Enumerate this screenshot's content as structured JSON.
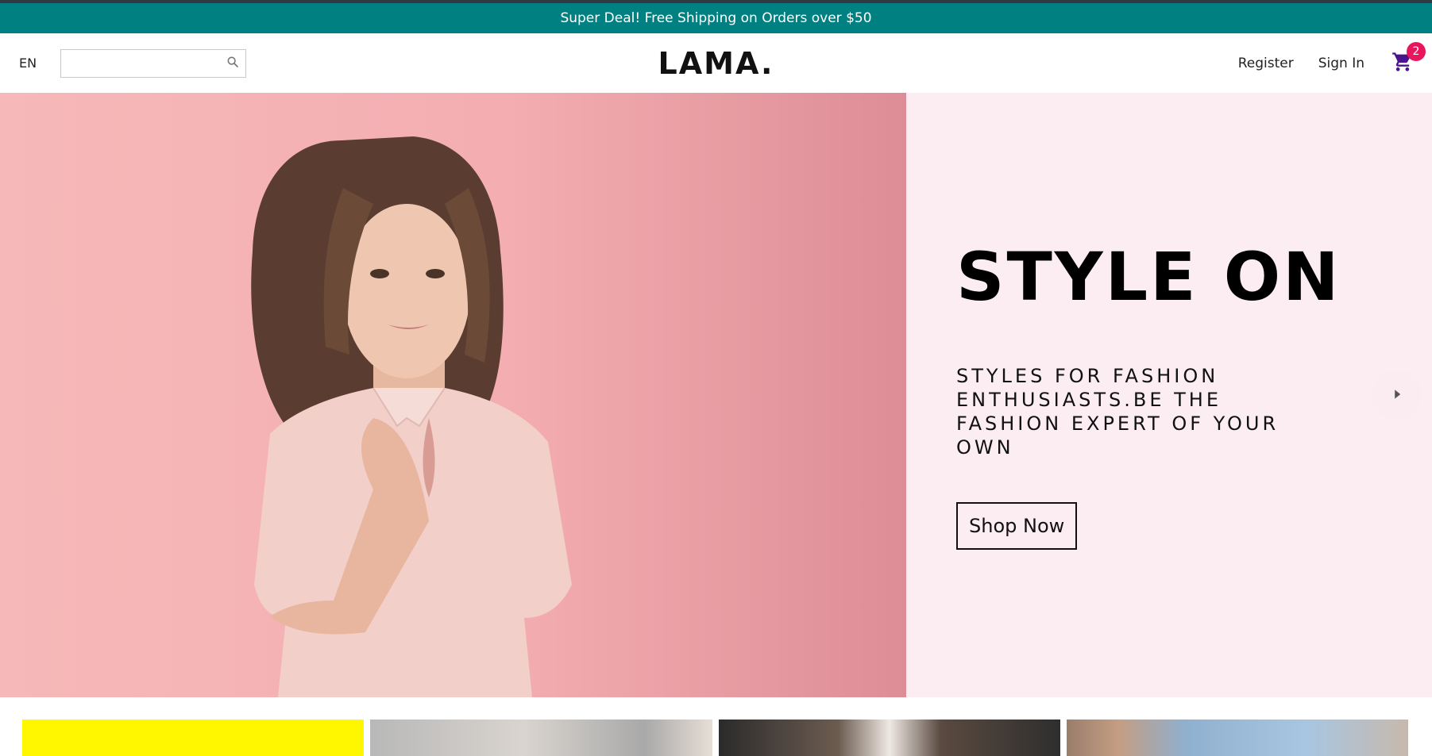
{
  "announcement": {
    "text": "Super Deal! Free Shipping on Orders over $50"
  },
  "navbar": {
    "language": "EN",
    "search": {
      "placeholder": "",
      "value": ""
    },
    "logo": "LAMA.",
    "register_label": "Register",
    "signin_label": "Sign In",
    "cart": {
      "count": "2"
    }
  },
  "hero": {
    "title": "STYLE ON",
    "description": "STYLES FOR FASHION ENTHUSIASTS.BE THE FASHION EXPERT OF YOUR OWN",
    "button_label": "Shop Now"
  },
  "icons": {
    "search": "search-icon",
    "cart": "shopping-cart-icon",
    "prev": "arrow-left-icon",
    "next": "arrow-right-icon"
  },
  "colors": {
    "announcement_bg": "#008080",
    "badge": "#e8175d",
    "cart_icon": "#4a148c",
    "slide_bg": "#fbedf1",
    "category_1": "#fff700"
  }
}
